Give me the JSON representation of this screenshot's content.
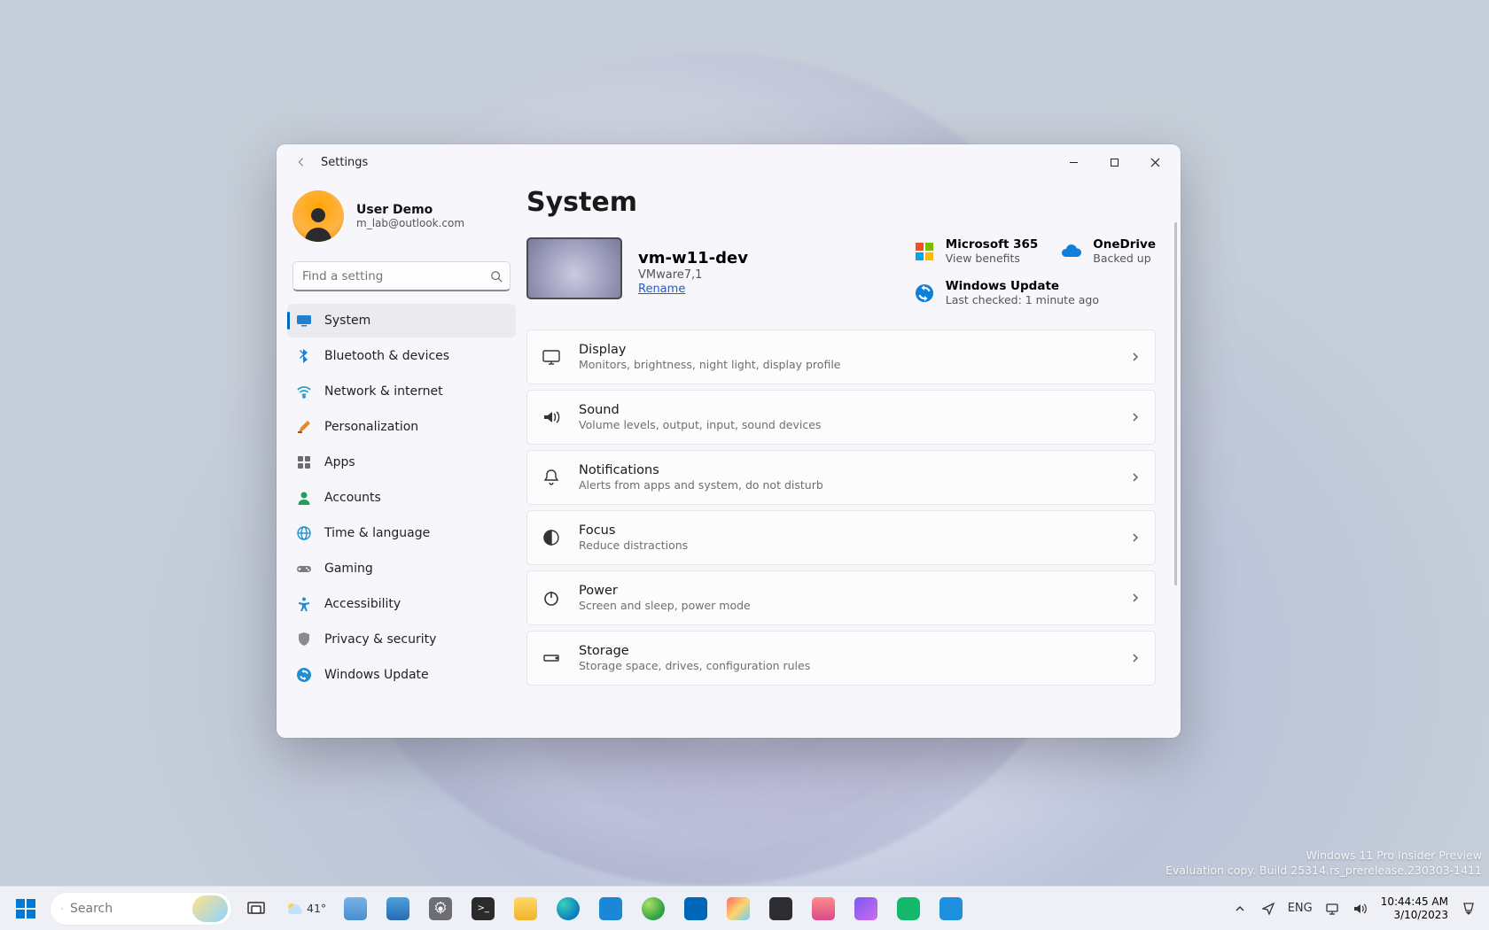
{
  "window": {
    "title": "Settings",
    "user": {
      "name": "User Demo",
      "email": "m_lab@outlook.com"
    },
    "search_placeholder": "Find a setting"
  },
  "sidebar": {
    "items": [
      {
        "label": "System",
        "icon": "monitor",
        "active": true
      },
      {
        "label": "Bluetooth & devices",
        "icon": "bluetooth"
      },
      {
        "label": "Network & internet",
        "icon": "wifi"
      },
      {
        "label": "Personalization",
        "icon": "brush"
      },
      {
        "label": "Apps",
        "icon": "apps"
      },
      {
        "label": "Accounts",
        "icon": "person"
      },
      {
        "label": "Time & language",
        "icon": "globe"
      },
      {
        "label": "Gaming",
        "icon": "gamepad"
      },
      {
        "label": "Accessibility",
        "icon": "accessibility"
      },
      {
        "label": "Privacy & security",
        "icon": "shield"
      },
      {
        "label": "Windows Update",
        "icon": "update"
      }
    ]
  },
  "main": {
    "heading": "System",
    "pc": {
      "name": "vm-w11-dev",
      "model": "VMware7,1",
      "rename": "Rename"
    },
    "cloud": {
      "m365": {
        "title": "Microsoft 365",
        "sub": "View benefits"
      },
      "onedrive": {
        "title": "OneDrive",
        "sub": "Backed up"
      },
      "update": {
        "title": "Windows Update",
        "sub": "Last checked: 1 minute ago"
      }
    },
    "cards": [
      {
        "title": "Display",
        "sub": "Monitors, brightness, night light, display profile",
        "icon": "display"
      },
      {
        "title": "Sound",
        "sub": "Volume levels, output, input, sound devices",
        "icon": "sound"
      },
      {
        "title": "Notifications",
        "sub": "Alerts from apps and system, do not disturb",
        "icon": "bell"
      },
      {
        "title": "Focus",
        "sub": "Reduce distractions",
        "icon": "focus"
      },
      {
        "title": "Power",
        "sub": "Screen and sleep, power mode",
        "icon": "power"
      },
      {
        "title": "Storage",
        "sub": "Storage space, drives, configuration rules",
        "icon": "storage"
      }
    ]
  },
  "desktop": {
    "watermark_line1": "Windows 11 Pro Insider Preview",
    "watermark_line2": "Evaluation copy. Build 25314.rs_prerelease.230303-1411"
  },
  "taskbar": {
    "search_placeholder": "Search",
    "weather_temp": "41°",
    "lang": "ENG",
    "time": "10:44:45 AM",
    "date": "3/10/2023"
  }
}
